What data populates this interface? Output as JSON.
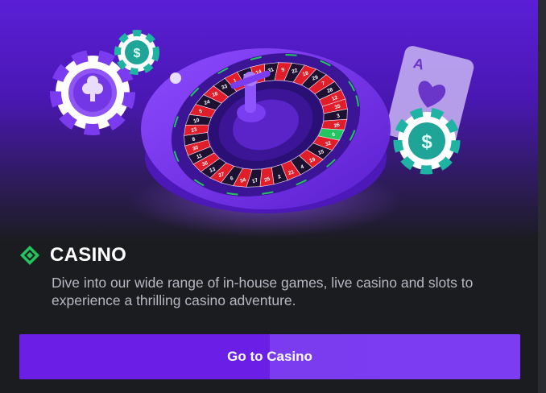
{
  "section": {
    "title": "CASINO",
    "description": "Dive into our wide range of in-house games, live casino and slots to experience a thrilling casino adventure.",
    "button_label": "Go to Casino",
    "icon": "casino-diamond-icon"
  },
  "hero": {
    "card_rank": "A",
    "wheel_numbers": [
      "35",
      "3",
      "26",
      "0",
      "32",
      "15",
      "19",
      "4",
      "21",
      "2",
      "25",
      "17",
      "34",
      "6",
      "27",
      "13",
      "36",
      "11",
      "30",
      "8",
      "23",
      "10",
      "5",
      "24",
      "16",
      "33",
      "1",
      "20",
      "14",
      "31",
      "9",
      "22",
      "18",
      "29",
      "7",
      "28",
      "12"
    ]
  },
  "colors": {
    "accent": "#6a1ee6",
    "green": "#22c55e",
    "teal_chip": "#1fb3a4",
    "wheel_red": "#e11d2a"
  }
}
